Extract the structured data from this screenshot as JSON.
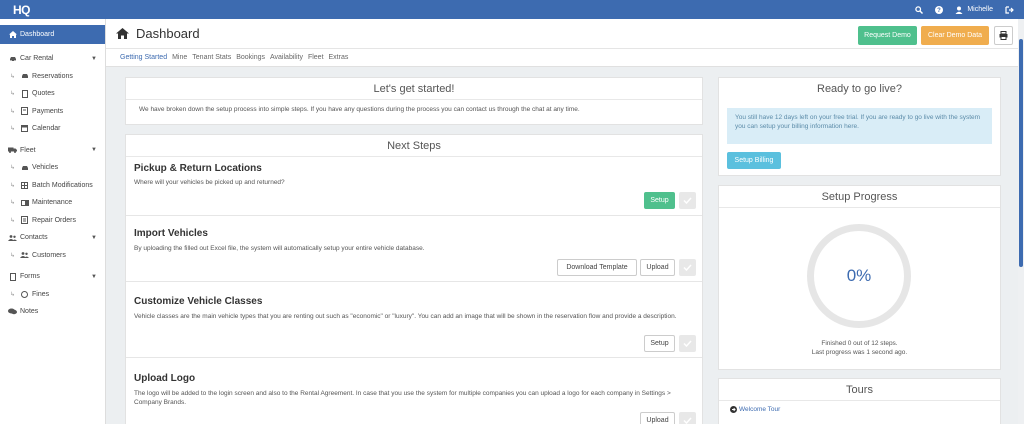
{
  "app": {
    "logo": "HQ"
  },
  "topbar": {
    "user_name": "Michelle"
  },
  "sidebar": {
    "dashboard": "Dashboard",
    "car_rental": "Car Rental",
    "reservations": "Reservations",
    "quotes": "Quotes",
    "payments": "Payments",
    "calendar": "Calendar",
    "fleet": "Fleet",
    "vehicles": "Vehicles",
    "batch_modifications": "Batch Modifications",
    "maintenance": "Maintenance",
    "repair_orders": "Repair Orders",
    "contacts": "Contacts",
    "customers": "Customers",
    "forms": "Forms",
    "fines": "Fines",
    "notes": "Notes"
  },
  "header": {
    "title": "Dashboard",
    "request_demo": "Request Demo",
    "clear_demo_data": "Clear Demo Data"
  },
  "tabs": [
    "Getting Started",
    "Mine",
    "Tenant Stats",
    "Bookings",
    "Availability",
    "Fleet",
    "Extras"
  ],
  "getting_started": {
    "title": "Let's get started!",
    "text": "We have broken down the setup process into simple steps. If you have any questions during the process you can contact us through the chat at any time."
  },
  "next_steps": {
    "title": "Next Steps",
    "steps": [
      {
        "title": "Pickup & Return Locations",
        "desc": "Where will your vehicles be picked up and returned?",
        "setup": "Setup"
      },
      {
        "title": "Import Vehicles",
        "desc": "By uploading the filled out Excel file, the system will automatically setup your entire vehicle database.",
        "download": "Download Template",
        "upload": "Upload"
      },
      {
        "title": "Customize Vehicle Classes",
        "desc": "Vehicle classes are the main vehicle types that you are renting out such as \"economic\" or \"luxury\". You can add an image that will be shown in the reservation flow and provide a description.",
        "setup": "Setup"
      },
      {
        "title": "Upload Logo",
        "desc": "The logo will be added to the login screen and also to the Rental Agreement. In case that you use the system for multiple companies you can upload a logo for each company in Settings > Company Brands.",
        "upload": "Upload"
      }
    ]
  },
  "go_live": {
    "title": "Ready to go live?",
    "info": "You still have 12 days left on your free trial. If you are ready to go live with the system you can setup your billing information here.",
    "button": "Setup Billing"
  },
  "setup_progress": {
    "title": "Setup Progress",
    "percent": "0%",
    "line1": "Finished 0 out of 12 steps.",
    "line2": "Last progress was 1 second ago."
  },
  "tours": {
    "title": "Tours",
    "welcome": "Welcome Tour"
  },
  "colors": {
    "brand": "#3d6bb0",
    "green": "#4fc08d",
    "orange": "#f0ad4e",
    "info": "#5bc0de"
  }
}
